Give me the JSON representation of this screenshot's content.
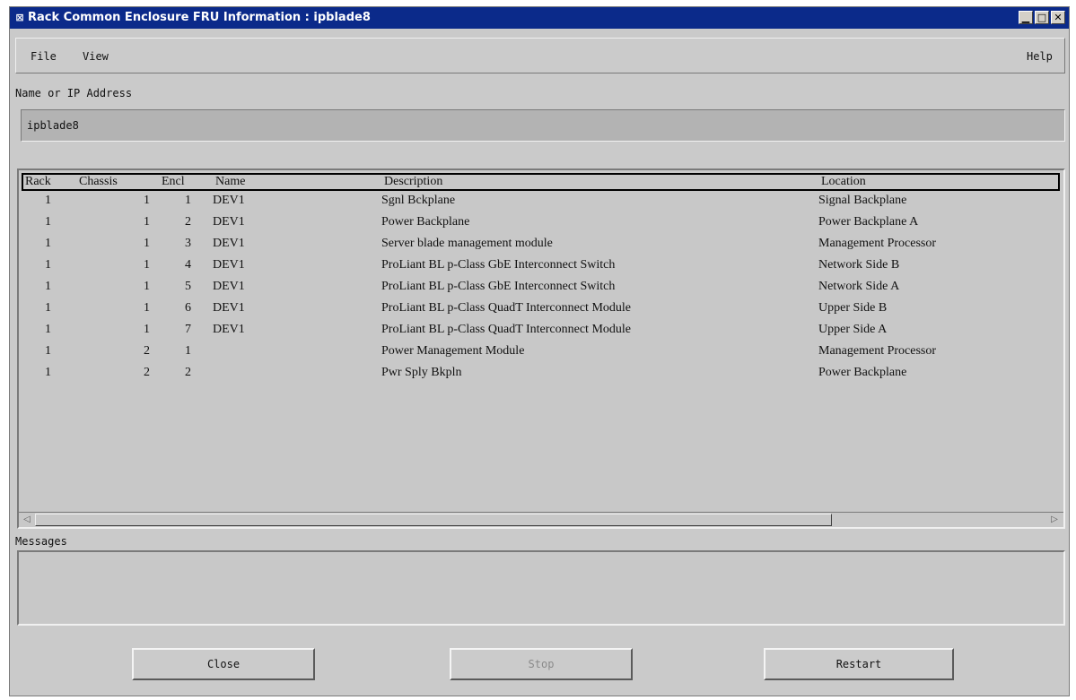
{
  "window": {
    "title": "Rack Common Enclosure FRU Information : ipblade8",
    "app_icon": "⊠",
    "minimize_glyph": "▁",
    "maximize_glyph": "□",
    "close_glyph": "✕"
  },
  "menubar": {
    "file": "File",
    "view": "View",
    "help": "Help"
  },
  "address": {
    "label": "Name or IP Address",
    "value": "ipblade8"
  },
  "table": {
    "headers": {
      "rack": "Rack",
      "chassis": "Chassis",
      "encl": "Encl",
      "name": "Name",
      "description": "Description",
      "location": "Location"
    },
    "rows": [
      {
        "rack": "1",
        "chassis": "1",
        "encl": "1",
        "name": "DEV1",
        "description": "Sgnl Bckplane",
        "location": "Signal Backplane"
      },
      {
        "rack": "1",
        "chassis": "1",
        "encl": "2",
        "name": "DEV1",
        "description": "Power Backplane",
        "location": "Power Backplane A"
      },
      {
        "rack": "1",
        "chassis": "1",
        "encl": "3",
        "name": "DEV1",
        "description": "Server blade management module",
        "location": "Management Processor"
      },
      {
        "rack": "1",
        "chassis": "1",
        "encl": "4",
        "name": "DEV1",
        "description": "ProLiant BL p-Class GbE Interconnect Switch",
        "location": "Network Side B"
      },
      {
        "rack": "1",
        "chassis": "1",
        "encl": "5",
        "name": "DEV1",
        "description": "ProLiant BL p-Class GbE Interconnect Switch",
        "location": "Network Side A"
      },
      {
        "rack": "1",
        "chassis": "1",
        "encl": "6",
        "name": "DEV1",
        "description": "ProLiant BL p-Class QuadT Interconnect Module",
        "location": "Upper Side B"
      },
      {
        "rack": "1",
        "chassis": "1",
        "encl": "7",
        "name": "DEV1",
        "description": "ProLiant BL p-Class QuadT Interconnect Module",
        "location": "Upper Side A"
      },
      {
        "rack": "1",
        "chassis": "2",
        "encl": "1",
        "name": "",
        "description": "Power Management Module",
        "location": "Management Processor"
      },
      {
        "rack": "1",
        "chassis": "2",
        "encl": "2",
        "name": "",
        "description": "Pwr Sply Bkpln",
        "location": "Power Backplane"
      }
    ]
  },
  "scrollbar": {
    "left_arrow": "◁",
    "right_arrow": "▷"
  },
  "messages": {
    "label": "Messages",
    "content": ""
  },
  "buttons": {
    "close": "Close",
    "stop": "Stop",
    "restart": "Restart"
  }
}
